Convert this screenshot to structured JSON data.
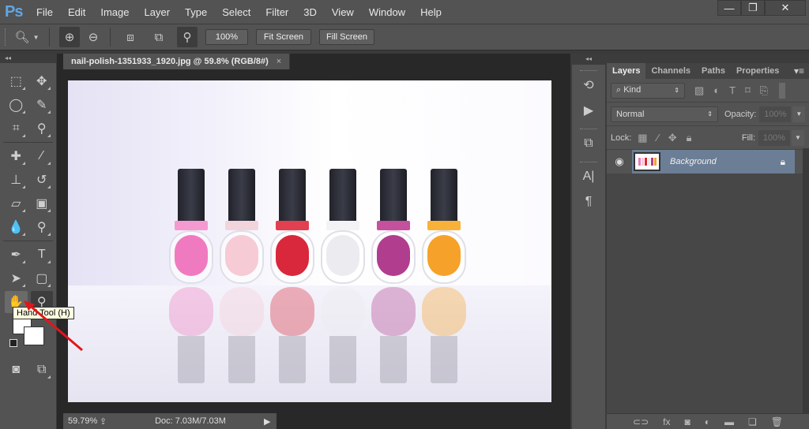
{
  "app": {
    "logo": "Ps"
  },
  "menu": [
    "File",
    "Edit",
    "Image",
    "Layer",
    "Type",
    "Select",
    "Filter",
    "3D",
    "View",
    "Window",
    "Help"
  ],
  "window_controls": {
    "minimize": "—",
    "restore": "❐",
    "close": "✕"
  },
  "options_bar": {
    "tool_icon": "zoom-icon",
    "buttons": {
      "actual": "100%",
      "fit": "Fit Screen",
      "fill": "Fill Screen"
    }
  },
  "document": {
    "tab_title": "nail-polish-1351933_1920.jpg @ 59.8% (RGB/8#)",
    "close": "×",
    "bottles": [
      {
        "color": "#f07ac0",
        "collar": "#f59ad0"
      },
      {
        "color": "#f6cbd6",
        "collar": "#f2d5dc"
      },
      {
        "color": "#d9283b",
        "collar": "#e24050"
      },
      {
        "color": "#ecebef",
        "collar": "#f3f3f5"
      },
      {
        "color": "#b03d8d",
        "collar": "#c5509e"
      },
      {
        "color": "#f6a22a",
        "collar": "#f8b23a"
      }
    ]
  },
  "status": {
    "zoom": "59.79%",
    "doc": "Doc: 7.03M/7.03M",
    "arrow": "▶",
    "share": "⇪"
  },
  "tooltip": "Hand Tool (H)",
  "toolbox": {
    "collapse": "◂◂"
  },
  "tools": [
    [
      "rect-marquee-icon",
      "move-icon"
    ],
    [
      "lasso-icon",
      "quick-select-icon"
    ],
    [
      "crop-icon",
      "eyedropper-icon"
    ],
    [
      "healing-brush-icon",
      "brush-icon"
    ],
    [
      "clone-stamp-icon",
      "history-brush-icon"
    ],
    [
      "eraser-icon",
      "gradient-icon"
    ],
    [
      "blur-icon",
      "dodge-icon"
    ],
    [
      "pen-icon",
      "type-icon"
    ],
    [
      "path-select-icon",
      "shape-icon"
    ],
    [
      "hand-icon",
      "zoom-icon"
    ]
  ],
  "tool_glyphs": {
    "rect-marquee-icon": "⬚",
    "move-icon": "✥",
    "lasso-icon": "◯",
    "quick-select-icon": "✎",
    "crop-icon": "⌗",
    "eyedropper-icon": "⚲",
    "healing-brush-icon": "✚",
    "brush-icon": "⁄",
    "clone-stamp-icon": "⊥",
    "history-brush-icon": "↺",
    "eraser-icon": "▱",
    "gradient-icon": "▣",
    "blur-icon": "💧",
    "dodge-icon": "⚲",
    "pen-icon": "✒",
    "type-icon": "T",
    "path-select-icon": "➤",
    "shape-icon": "▢",
    "hand-icon": "✋",
    "zoom-icon": "⚲"
  },
  "dock": {
    "icons": [
      "history-icon",
      "actions-play-icon",
      "clone-source-icon",
      "character-icon",
      "paragraph-icon"
    ],
    "glyphs": [
      "⟲",
      "▶",
      "⧉",
      "A|",
      "¶"
    ]
  },
  "layers_panel": {
    "tabs": [
      "Layers",
      "Channels",
      "Paths",
      "Properties"
    ],
    "active_tab": "Layers",
    "kind": "Kind",
    "blend_mode": "Normal",
    "opacity_label": "Opacity:",
    "opacity_value": "100%",
    "lock_label": "Lock:",
    "fill_label": "Fill:",
    "fill_value": "100%",
    "layers": [
      {
        "name": "Background",
        "visible": true,
        "locked": true
      }
    ],
    "selection_color": "#6b7e96"
  },
  "footer_icons": [
    "link-layers-icon",
    "fx-icon",
    "mask-icon",
    "adjustment-icon",
    "group-icon",
    "new-layer-icon",
    "trash-icon"
  ],
  "footer_glyphs": [
    "⊂⊃",
    "fx",
    "◙",
    "◐",
    "▬",
    "❏",
    "🗑"
  ]
}
